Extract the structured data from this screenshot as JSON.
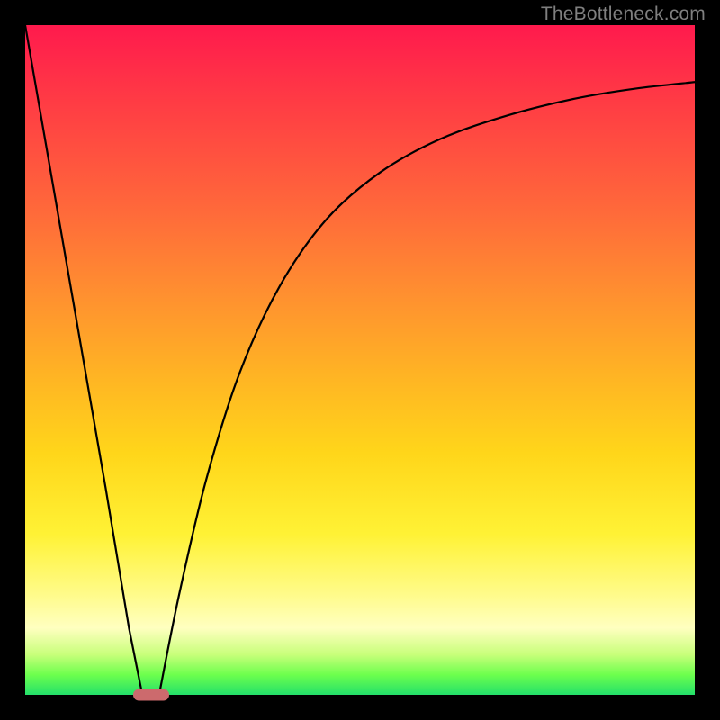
{
  "watermark": "TheBottleneck.com",
  "chart_data": {
    "type": "line",
    "title": "",
    "xlabel": "",
    "ylabel": "",
    "xlim": [
      0,
      100
    ],
    "ylim": [
      0,
      100
    ],
    "grid": false,
    "legend": false,
    "series": [
      {
        "name": "left-branch",
        "x": [
          0,
          4,
          8,
          12,
          15.5,
          17.5
        ],
        "values": [
          100,
          77,
          54,
          31,
          10,
          0
        ]
      },
      {
        "name": "right-branch",
        "x": [
          20,
          23,
          27,
          32,
          38,
          45,
          53,
          62,
          72,
          82,
          91,
          100
        ],
        "values": [
          0,
          15,
          32,
          48,
          61,
          71,
          78,
          83,
          86.5,
          89,
          90.5,
          91.5
        ]
      }
    ],
    "marker": {
      "x": 18.8,
      "y": 0,
      "shape": "pill",
      "color": "#cc6a6d"
    },
    "background_gradient": {
      "orientation": "vertical",
      "stops": [
        {
          "pos": 0.0,
          "color": "#ff1a4d"
        },
        {
          "pos": 0.28,
          "color": "#ff6a3a"
        },
        {
          "pos": 0.52,
          "color": "#ffb324"
        },
        {
          "pos": 0.76,
          "color": "#fff235"
        },
        {
          "pos": 0.9,
          "color": "#ffffc0"
        },
        {
          "pos": 1.0,
          "color": "#23e06a"
        }
      ]
    }
  }
}
